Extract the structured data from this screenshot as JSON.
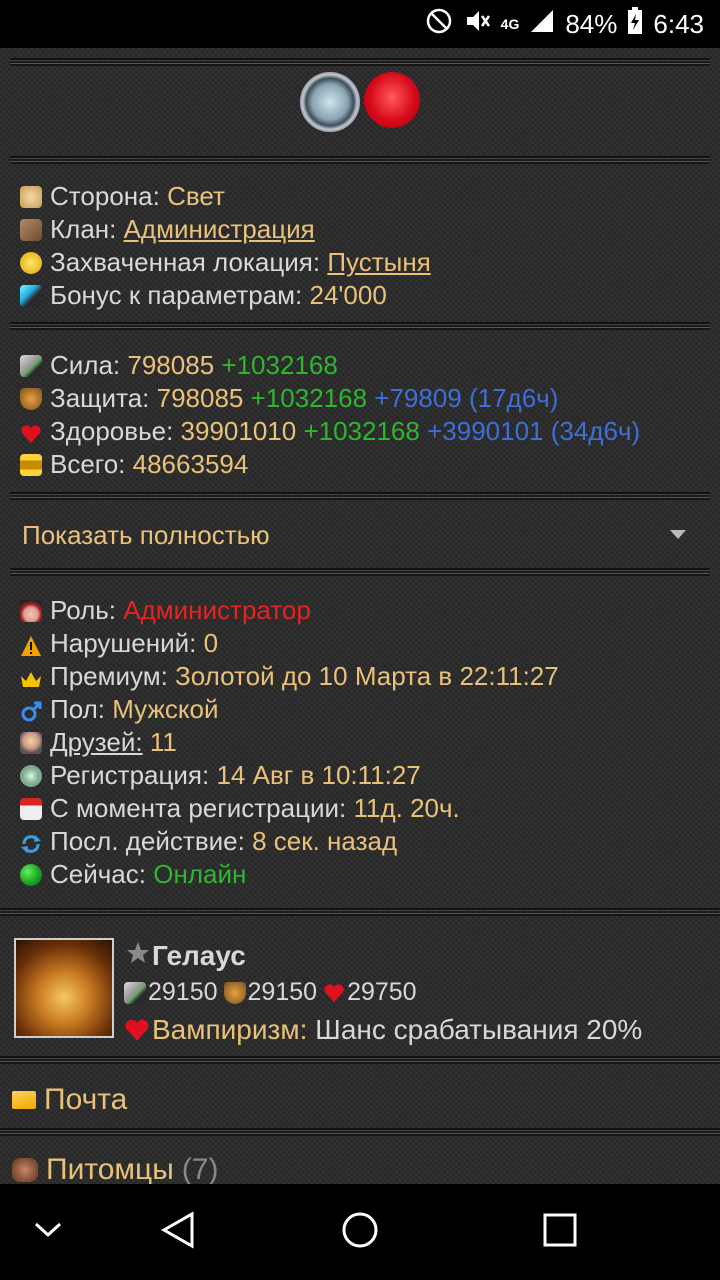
{
  "status_bar": {
    "network": "4G",
    "battery": "84%",
    "time": "6:43",
    "icons": [
      "dnd-icon",
      "mute-icon",
      "signal-icon",
      "battery-charging-icon"
    ]
  },
  "profile": {
    "items_icons": [
      "watch-icon",
      "lips-icon"
    ],
    "side_label": "Сторона:",
    "side_value": "Свет",
    "clan_label": "Клан:",
    "clan_value": "Администрация",
    "location_label": "Захваченная локация:",
    "location_value": "Пустыня",
    "bonus_label": "Бонус к параметрам:",
    "bonus_value": "24'000"
  },
  "stats": {
    "strength_label": "Сила:",
    "strength_value": "798085",
    "strength_bonus": "+1032168",
    "defense_label": "Защита:",
    "defense_value": "798085",
    "defense_bonus": "+1032168",
    "defense_extra": "+79809 (17д6ч)",
    "health_label": "Здоровье:",
    "health_value": "39901010",
    "health_bonus": "+1032168",
    "health_extra": "+3990101 (34д6ч)",
    "total_label": "Всего:",
    "total_value": "48663594"
  },
  "show_full": "Показать полностью",
  "info": {
    "role_label": "Роль:",
    "role_value": "Администратор",
    "violations_label": "Нарушений:",
    "violations_value": "0",
    "premium_label": "Премиум:",
    "premium_value": "Золотой до 10 Марта в 22:11:27",
    "gender_label": "Пол:",
    "gender_value": "Мужской",
    "friends_label": "Друзей:",
    "friends_value": "11",
    "registration_label": "Регистрация:",
    "registration_value": "14 Авг в 10:11:27",
    "since_label": "С момента регистрации:",
    "since_value": "11д. 20ч.",
    "last_action_label": "Посл. действие:",
    "last_action_value": "8 сек. назад",
    "now_label": "Сейчас:",
    "now_value": "Онлайн"
  },
  "pet": {
    "name": "Гелаус",
    "strength": "29150",
    "defense": "29150",
    "health": "29750",
    "ability_name": "Вампиризм:",
    "ability_desc": "Шанс срабатывания 20%"
  },
  "menu": {
    "mail": "Почта",
    "pets": "Питомцы",
    "pets_count": "(7)"
  },
  "colors": {
    "gold": "#e8c27a",
    "green": "#2fb52f",
    "blue": "#3d6fd6",
    "red": "#e52323"
  }
}
